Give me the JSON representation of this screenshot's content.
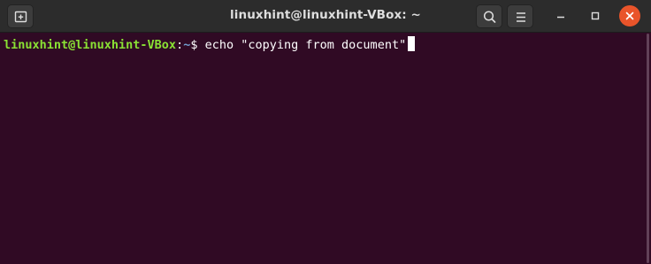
{
  "window": {
    "title": "linuxhint@linuxhint-VBox: ~"
  },
  "titlebar": {
    "new_tab_icon": "new-tab-icon",
    "search_icon": "search-icon",
    "menu_icon": "hamburger-menu-icon",
    "minimize_icon": "minimize-icon",
    "maximize_icon": "maximize-icon",
    "close_icon": "close-icon"
  },
  "terminal": {
    "prompt_user": "linuxhint@linuxhint-VBox",
    "prompt_colon": ":",
    "prompt_path": "~",
    "prompt_symbol": "$ ",
    "command": "echo \"copying from document\""
  },
  "colors": {
    "background": "#300a24",
    "titlebar": "#2c2c2c",
    "prompt_user": "#8ae234",
    "prompt_path": "#729fcf",
    "close_button": "#e9542a"
  }
}
